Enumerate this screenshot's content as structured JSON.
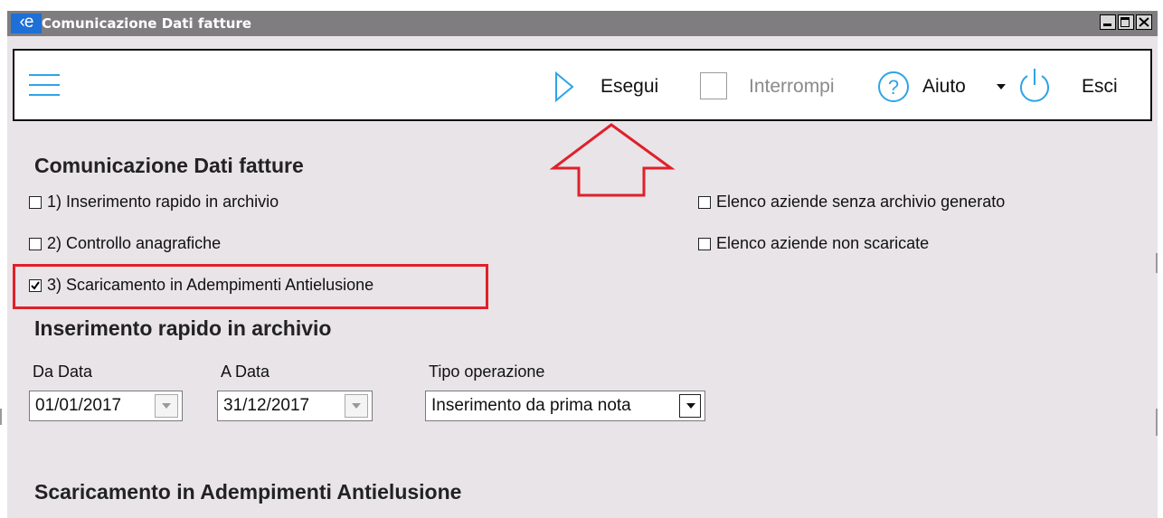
{
  "window": {
    "logo_text": "‹e",
    "title": "Comunicazione Dati fatture"
  },
  "toolbar": {
    "esegui_label": "Esegui",
    "interrompi_label": "Interrompi",
    "aiuto_label": "Aiuto",
    "esci_label": "Esci",
    "icons": [
      "menu-icon",
      "play-icon",
      "stop-icon",
      "help-icon",
      "chevron-down-icon",
      "power-icon"
    ],
    "accent_color": "#2fa3e6"
  },
  "main": {
    "section_title": "Comunicazione Dati fatture",
    "options_left": [
      {
        "label": "1) Inserimento rapido in archivio",
        "checked": false
      },
      {
        "label": "2) Controllo anagrafiche",
        "checked": false
      },
      {
        "label": "3) Scaricamento in Adempimenti Antielusione",
        "checked": true
      }
    ],
    "options_right": [
      {
        "label": "Elenco aziende senza archivio generato",
        "checked": false
      },
      {
        "label": "Elenco aziende non scaricate",
        "checked": false
      }
    ]
  },
  "inserimento": {
    "title": "Inserimento rapido in archivio",
    "da_data_label": "Da Data",
    "da_data_value": "01/01/2017",
    "a_data_label": "A Data",
    "a_data_value": "31/12/2017",
    "tipo_label": "Tipo operazione",
    "tipo_value": "Inserimento da prima nota"
  },
  "scaricamento": {
    "title": "Scaricamento in Adempimenti Antielusione"
  },
  "annotations": {
    "highlight_color": "#e0202a"
  }
}
